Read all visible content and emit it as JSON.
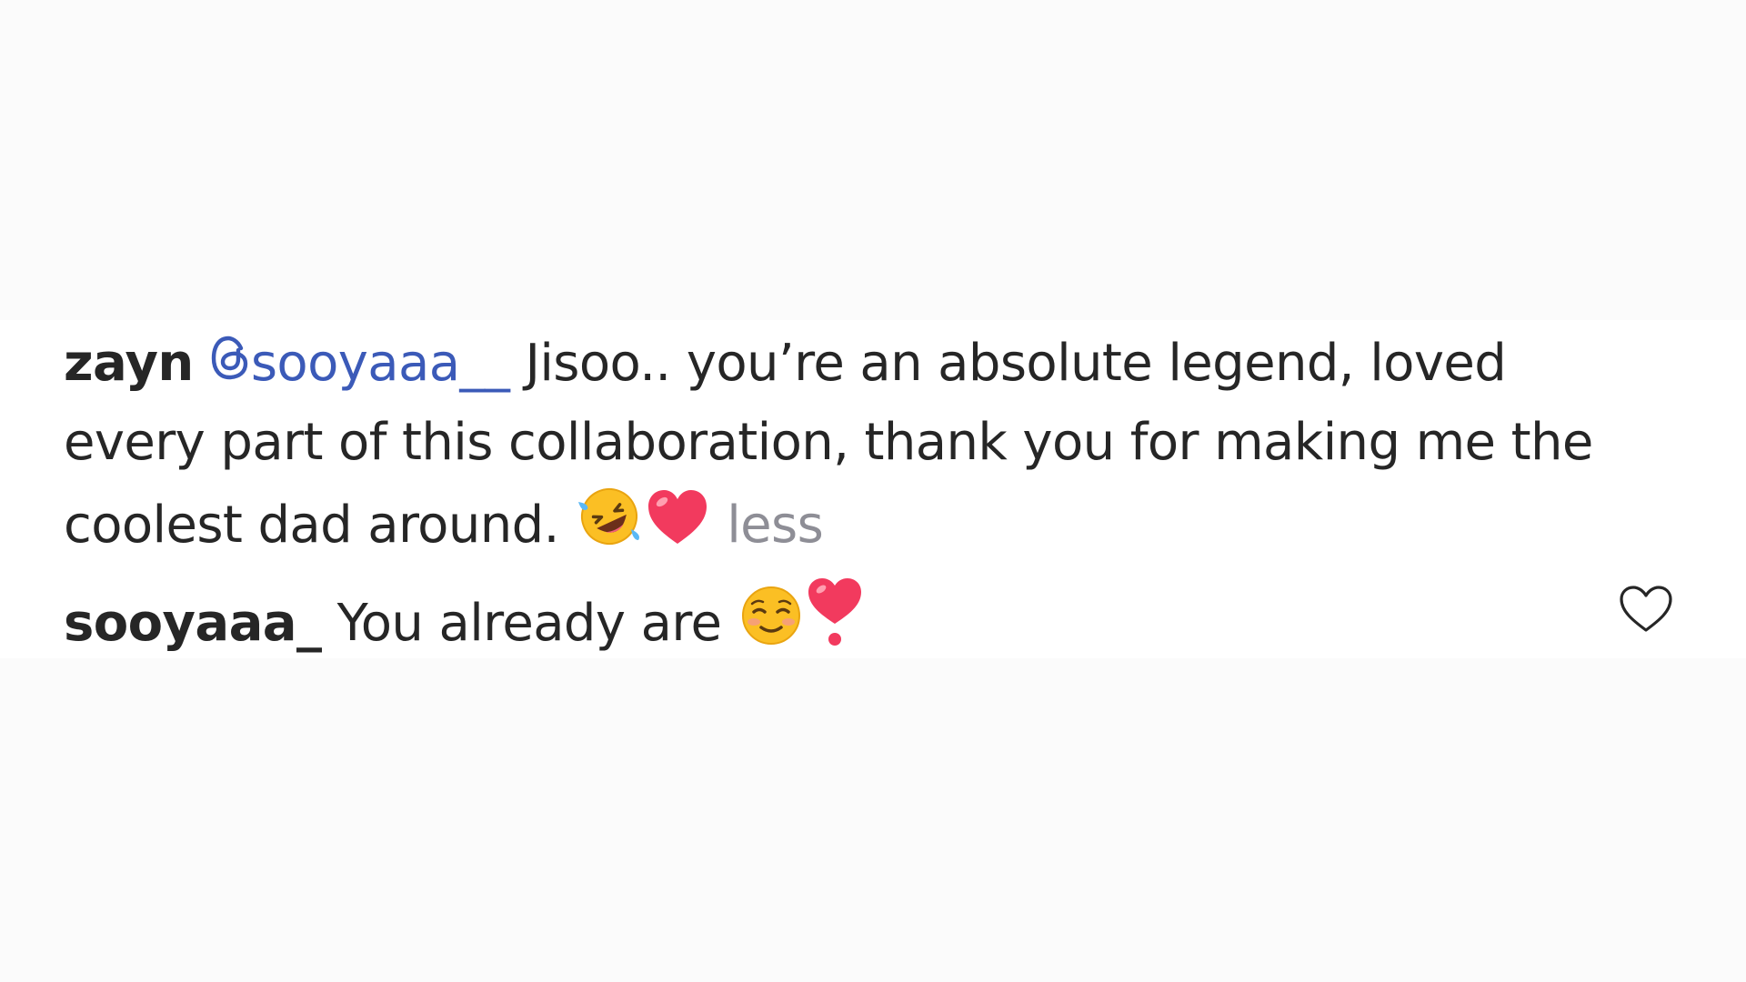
{
  "comments": [
    {
      "username": "zayn",
      "mention": "sooyaaa__",
      "text_line1": "Jisoo.. you’re an absolute legend, loved",
      "text_line2": "every part of this collaboration, thank you for making me the",
      "text_line3": "coolest dad around.",
      "emojis": [
        "rolling-on-floor-laughing-emoji",
        "red-heart-emoji"
      ],
      "expand_toggle": "less"
    },
    {
      "username": "sooyaaa_",
      "text": "You already are",
      "emojis": [
        "smiling-face-emoji",
        "heart-exclamation-emoji"
      ],
      "like_icon": "heart-outline-icon"
    }
  ],
  "colors": {
    "text": "#262626",
    "mention": "#3b5ab8",
    "muted": "#8e8e96",
    "heart": "#f23a5e",
    "background": "#fbfbfb"
  }
}
